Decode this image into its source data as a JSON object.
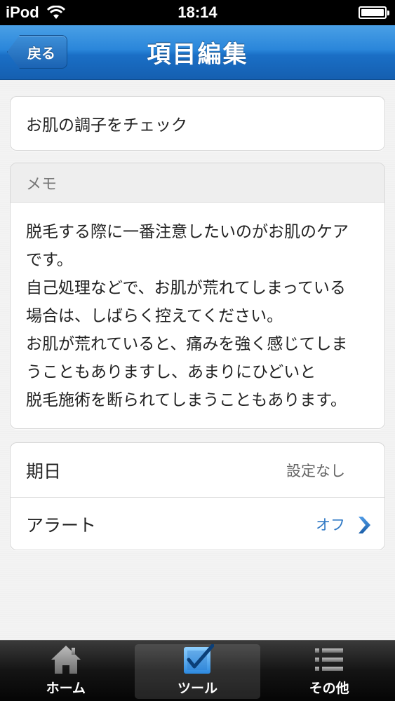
{
  "status_bar": {
    "carrier": "iPod",
    "time": "18:14"
  },
  "nav": {
    "back_label": "戻る",
    "title": "項目編集"
  },
  "item": {
    "title": "お肌の調子をチェック"
  },
  "memo": {
    "header": "メモ",
    "lines": [
      "脱毛する際に一番注意したいのがお肌のケア",
      "です。",
      "自己処理などで、お肌が荒れてしまっている",
      "場合は、しばらく控えてください。",
      "お肌が荒れていると、痛みを強く感じてしま",
      "うこともありますし、あまりにひどいと",
      "脱毛施術を断られてしまうこともあります。"
    ]
  },
  "settings": {
    "due_date_label": "期日",
    "due_date_value": "設定なし",
    "alert_label": "アラート",
    "alert_value": "オフ"
  },
  "tabs": [
    {
      "label": "ホーム",
      "icon": "home-icon",
      "selected": false
    },
    {
      "label": "ツール",
      "icon": "checkbox-icon",
      "selected": true
    },
    {
      "label": "その他",
      "icon": "list-icon",
      "selected": false
    }
  ],
  "colors": {
    "nav_blue": "#2a86da",
    "accent_blue": "#2f78c4"
  }
}
